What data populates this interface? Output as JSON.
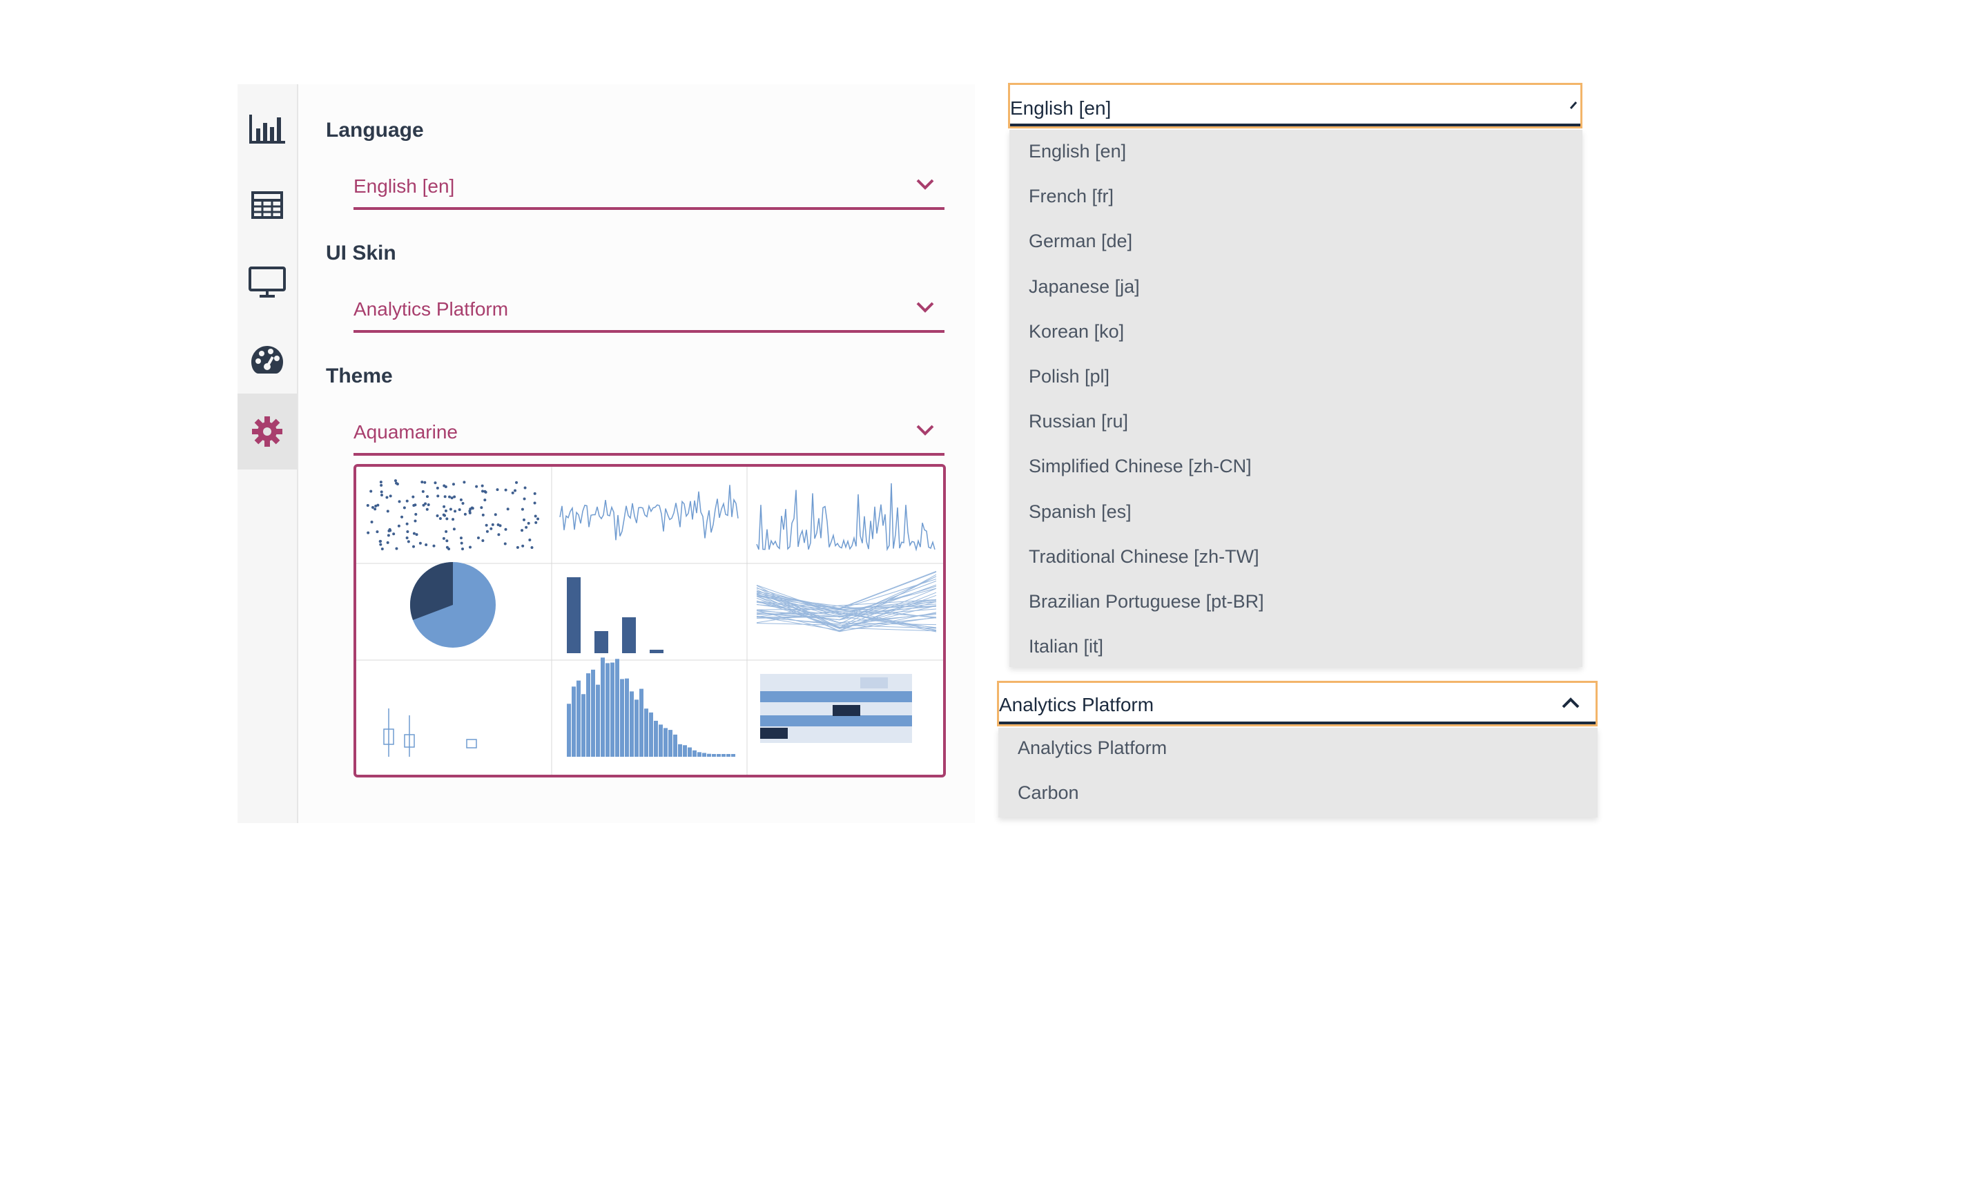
{
  "sidebar": {
    "items": [
      {
        "icon": "bar-chart-icon"
      },
      {
        "icon": "table-icon"
      },
      {
        "icon": "monitor-icon"
      },
      {
        "icon": "palette-icon"
      },
      {
        "icon": "gear-icon",
        "active": true
      }
    ]
  },
  "settings": {
    "language": {
      "label": "Language",
      "value": "English [en]"
    },
    "ui_skin": {
      "label": "UI Skin",
      "value": "Analytics Platform"
    },
    "theme": {
      "label": "Theme",
      "value": "Aquamarine"
    }
  },
  "language_dropdown": {
    "selected": "English [en]",
    "options": [
      "English [en]",
      "French [fr]",
      "German [de]",
      "Japanese [ja]",
      "Korean [ko]",
      "Polish [pl]",
      "Russian [ru]",
      "Simplified Chinese [zh-CN]",
      "Spanish [es]",
      "Traditional Chinese [zh-TW]",
      "Brazilian Portuguese [pt-BR]",
      "Italian [it]"
    ]
  },
  "skin_dropdown": {
    "selected": "Analytics Platform",
    "options": [
      "Analytics Platform",
      "Carbon"
    ]
  },
  "colors": {
    "accent": "#a83e6d",
    "focus_border": "#f3b56a",
    "text_dark": "#2e3a4b",
    "chart_blue": "#6f9bd0",
    "chart_navy": "#2f4668"
  }
}
